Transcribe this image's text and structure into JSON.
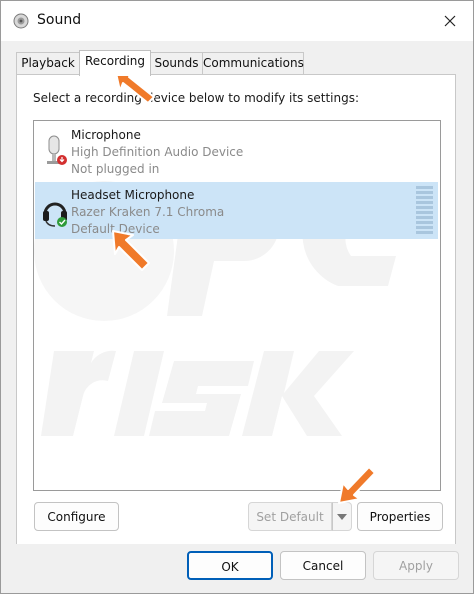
{
  "window": {
    "title": "Sound"
  },
  "tabs": [
    {
      "label": "Playback"
    },
    {
      "label": "Recording"
    },
    {
      "label": "Sounds"
    },
    {
      "label": "Communications"
    }
  ],
  "instruction": "Select a recording device below to modify its settings:",
  "devices": [
    {
      "name": "Microphone",
      "description": "High Definition Audio Device",
      "status": "Not plugged in",
      "icon": "microphone-icon",
      "status_badge": "red-down-arrow"
    },
    {
      "name": "Headset Microphone",
      "description": "Razer Kraken 7.1 Chroma",
      "status": "Default Device",
      "icon": "headset-icon",
      "status_badge": "green-check"
    }
  ],
  "buttons": {
    "configure": "Configure",
    "set_default": "Set Default",
    "properties": "Properties",
    "ok": "OK",
    "cancel": "Cancel",
    "apply": "Apply"
  },
  "colors": {
    "selection": "#cce4f7",
    "annotation_arrow": "#f07a2a"
  }
}
